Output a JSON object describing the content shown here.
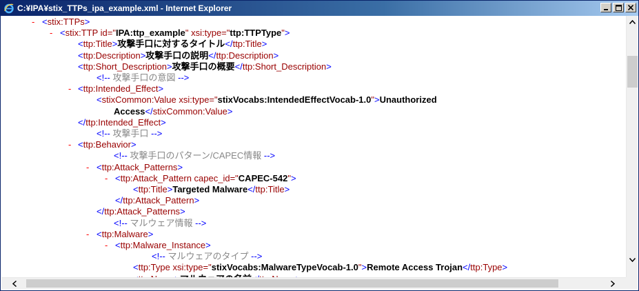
{
  "window": {
    "title": "C:¥IPA¥stix_TTPs_ipa_example.xml - Internet Explorer",
    "icon": "internet-explorer-icon",
    "buttons": [
      "minimize-icon",
      "maximize-icon",
      "close-icon"
    ]
  },
  "colors": {
    "minus": "#ff0000",
    "tag": "#990000",
    "bracket": "#0000ff",
    "comment": "#888888",
    "titlebar_start": "#0a246a",
    "titlebar_end": "#a6caf0"
  },
  "lines": [
    {
      "minus": "-",
      "segs": [
        [
          "br",
          "<"
        ],
        [
          "tag",
          "stix:TTPs"
        ],
        [
          "br",
          ">"
        ]
      ]
    },
    {
      "minus": "-",
      "segs": [
        [
          "br",
          "<"
        ],
        [
          "tag",
          "stix:TTP"
        ],
        [
          "an",
          " id=\""
        ],
        [
          "av",
          "IPA:ttp_example"
        ],
        [
          "an",
          "\" xsi:type=\""
        ],
        [
          "av",
          "ttp:TTPType"
        ],
        [
          "an",
          "\""
        ],
        [
          "br",
          ">"
        ]
      ]
    },
    {
      "minus": "",
      "segs": [
        [
          "br",
          "<"
        ],
        [
          "tag",
          "ttp:Title"
        ],
        [
          "br",
          ">"
        ],
        [
          "txt",
          "攻撃手口に対するタイトル"
        ],
        [
          "br",
          "</"
        ],
        [
          "tag",
          "ttp:Title"
        ],
        [
          "br",
          ">"
        ]
      ]
    },
    {
      "minus": "",
      "segs": [
        [
          "br",
          "<"
        ],
        [
          "tag",
          "ttp:Description"
        ],
        [
          "br",
          ">"
        ],
        [
          "txt",
          "攻撃手口の説明"
        ],
        [
          "br",
          "</"
        ],
        [
          "tag",
          "ttp:Description"
        ],
        [
          "br",
          ">"
        ]
      ]
    },
    {
      "minus": "",
      "segs": [
        [
          "br",
          "<"
        ],
        [
          "tag",
          "ttp:Short_Description"
        ],
        [
          "br",
          ">"
        ],
        [
          "txt",
          "攻撃手口の概要"
        ],
        [
          "br",
          "</"
        ],
        [
          "tag",
          "ttp:Short_Description"
        ],
        [
          "br",
          ">"
        ]
      ]
    },
    {
      "minus": "",
      "segs": [
        [
          "cmtb",
          "<!--"
        ],
        [
          "cmt",
          " 攻撃手口の意図 "
        ],
        [
          "cmtb",
          "-->"
        ]
      ]
    },
    {
      "minus": "-",
      "segs": [
        [
          "br",
          "<"
        ],
        [
          "tag",
          "ttp:Intended_Effect"
        ],
        [
          "br",
          ">"
        ]
      ]
    },
    {
      "minus": "",
      "segs": [
        [
          "br",
          "<"
        ],
        [
          "tag",
          "stixCommon:Value"
        ],
        [
          "an",
          " xsi:type=\""
        ],
        [
          "av",
          "stixVocabs:IntendedEffectVocab-1.0"
        ],
        [
          "an",
          "\""
        ],
        [
          "br",
          ">"
        ],
        [
          "txt",
          "Unauthorized"
        ]
      ]
    },
    {
      "minus": "",
      "segs": [
        [
          "txt",
          "Access"
        ],
        [
          "br",
          "</"
        ],
        [
          "tag",
          "stixCommon:Value"
        ],
        [
          "br",
          ">"
        ]
      ]
    },
    {
      "minus": "",
      "segs": [
        [
          "br",
          "</"
        ],
        [
          "tag",
          "ttp:Intended_Effect"
        ],
        [
          "br",
          ">"
        ]
      ]
    },
    {
      "minus": "",
      "segs": [
        [
          "cmtb",
          "<!--"
        ],
        [
          "cmt",
          " 攻撃手口 "
        ],
        [
          "cmtb",
          "-->"
        ]
      ]
    },
    {
      "minus": "-",
      "segs": [
        [
          "br",
          "<"
        ],
        [
          "tag",
          "ttp:Behavior"
        ],
        [
          "br",
          ">"
        ]
      ]
    },
    {
      "minus": "",
      "segs": [
        [
          "cmtb",
          "<!--"
        ],
        [
          "cmt",
          " 攻撃手口のパターン/CAPEC情報 "
        ],
        [
          "cmtb",
          "-->"
        ]
      ]
    },
    {
      "minus": "-",
      "segs": [
        [
          "br",
          "<"
        ],
        [
          "tag",
          "ttp:Attack_Patterns"
        ],
        [
          "br",
          ">"
        ]
      ]
    },
    {
      "minus": "-",
      "segs": [
        [
          "br",
          "<"
        ],
        [
          "tag",
          "ttp:Attack_Pattern"
        ],
        [
          "an",
          " capec_id=\""
        ],
        [
          "av",
          "CAPEC-542"
        ],
        [
          "an",
          "\""
        ],
        [
          "br",
          ">"
        ]
      ]
    },
    {
      "minus": "",
      "segs": [
        [
          "br",
          "<"
        ],
        [
          "tag",
          "ttp:Title"
        ],
        [
          "br",
          ">"
        ],
        [
          "txt",
          "Targeted Malware"
        ],
        [
          "br",
          "</"
        ],
        [
          "tag",
          "ttp:Title"
        ],
        [
          "br",
          ">"
        ]
      ]
    },
    {
      "minus": "",
      "segs": [
        [
          "br",
          "</"
        ],
        [
          "tag",
          "ttp:Attack_Pattern"
        ],
        [
          "br",
          ">"
        ]
      ]
    },
    {
      "minus": "",
      "segs": [
        [
          "br",
          "</"
        ],
        [
          "tag",
          "ttp:Attack_Patterns"
        ],
        [
          "br",
          ">"
        ]
      ]
    },
    {
      "minus": "",
      "segs": [
        [
          "cmtb",
          "<!--"
        ],
        [
          "cmt",
          " マルウェア情報 "
        ],
        [
          "cmtb",
          "-->"
        ]
      ]
    },
    {
      "minus": "-",
      "segs": [
        [
          "br",
          "<"
        ],
        [
          "tag",
          "ttp:Malware"
        ],
        [
          "br",
          ">"
        ]
      ]
    },
    {
      "minus": "-",
      "segs": [
        [
          "br",
          "<"
        ],
        [
          "tag",
          "ttp:Malware_Instance"
        ],
        [
          "br",
          ">"
        ]
      ]
    },
    {
      "minus": "",
      "segs": [
        [
          "cmtb",
          "<!--"
        ],
        [
          "cmt",
          " マルウェアのタイプ "
        ],
        [
          "cmtb",
          "-->"
        ]
      ]
    },
    {
      "minus": "",
      "segs": [
        [
          "br",
          "<"
        ],
        [
          "tag",
          "ttp:Type"
        ],
        [
          "an",
          " xsi:type=\""
        ],
        [
          "av",
          "stixVocabs:MalwareTypeVocab-1.0"
        ],
        [
          "an",
          "\""
        ],
        [
          "br",
          ">"
        ],
        [
          "txt",
          "Remote Access Trojan"
        ],
        [
          "br",
          "</"
        ],
        [
          "tag",
          "ttp:Type"
        ],
        [
          "br",
          ">"
        ]
      ]
    },
    {
      "minus": "",
      "segs": [
        [
          "br",
          "<"
        ],
        [
          "tag",
          "ttp:Name"
        ],
        [
          "br",
          ">"
        ],
        [
          "txt",
          "マルウェアの名前"
        ],
        [
          "br",
          "</"
        ],
        [
          "tag",
          "ttp:Name"
        ],
        [
          "br",
          ">"
        ]
      ]
    }
  ]
}
